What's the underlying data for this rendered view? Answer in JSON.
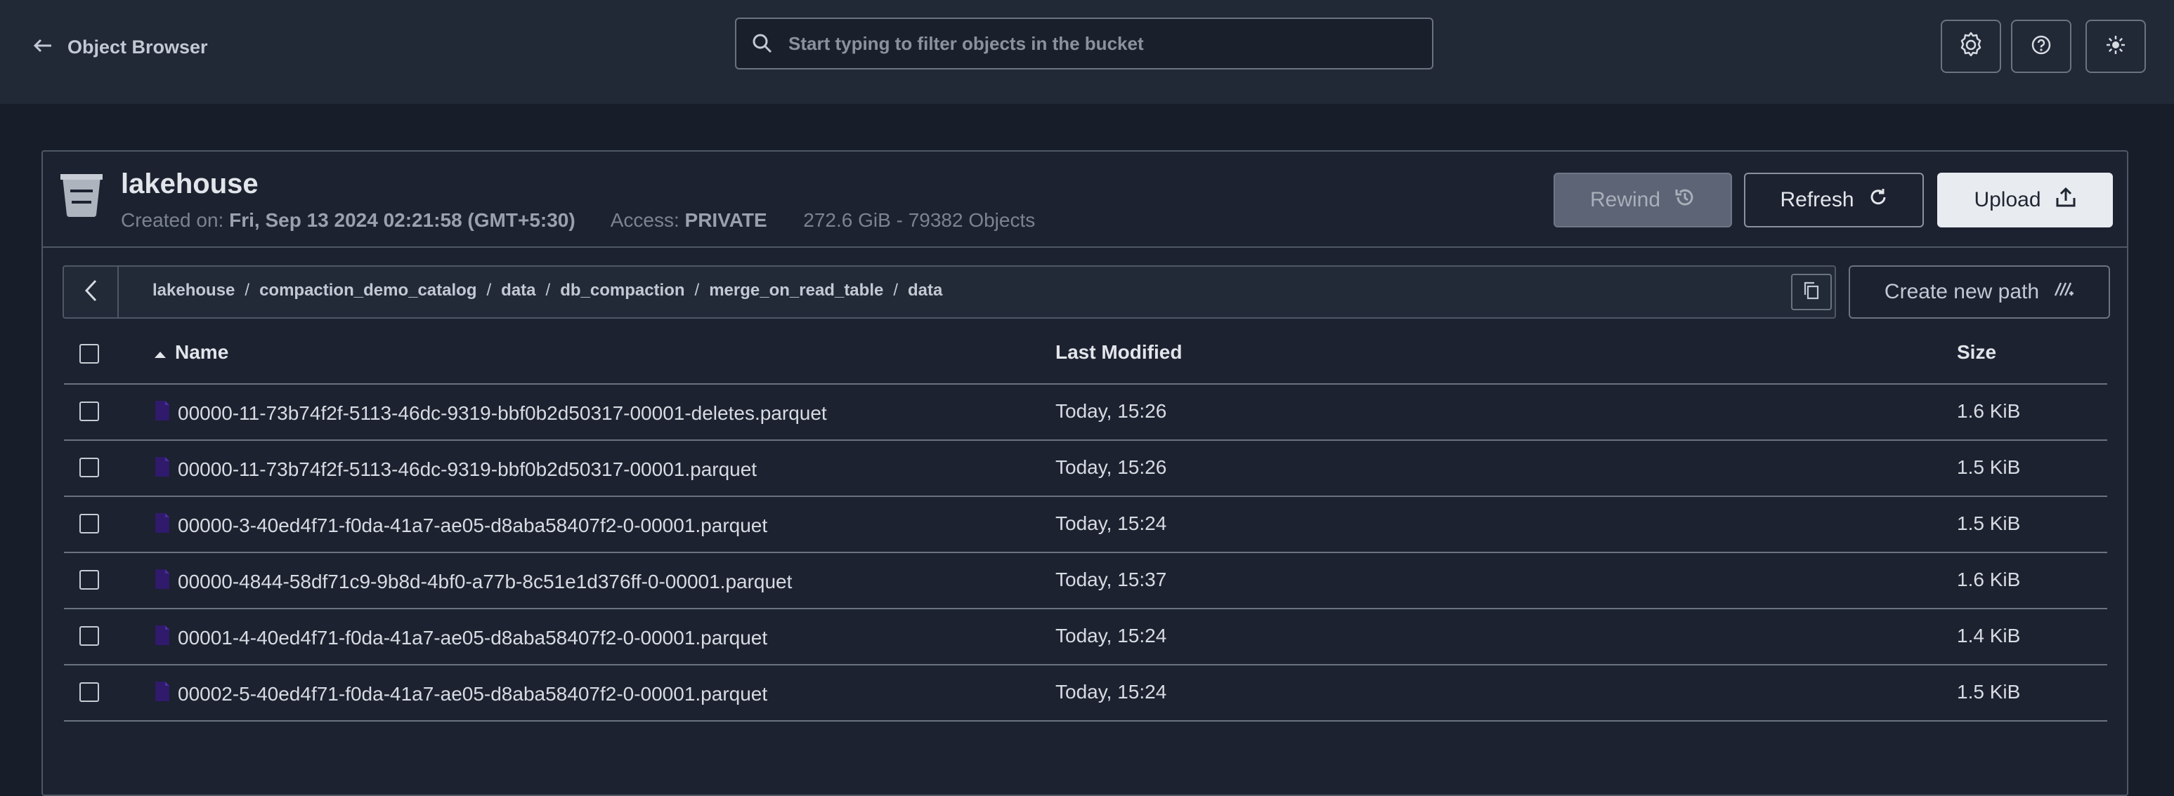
{
  "topbar": {
    "back_label": "Object Browser",
    "search_placeholder": "Start typing to filter objects in the bucket"
  },
  "bucket": {
    "name": "lakehouse",
    "created_label": "Created on:",
    "created_value": "Fri, Sep 13 2024 02:21:58 (GMT+5:30)",
    "access_label": "Access:",
    "access_value": "PRIVATE",
    "usage": "272.6 GiB - 79382 Objects"
  },
  "actions": {
    "rewind": "Rewind",
    "refresh": "Refresh",
    "upload": "Upload",
    "create_path": "Create new path"
  },
  "breadcrumb": [
    "lakehouse",
    "compaction_demo_catalog",
    "data",
    "db_compaction",
    "merge_on_read_table",
    "data"
  ],
  "table": {
    "columns": {
      "name": "Name",
      "modified": "Last Modified",
      "size": "Size"
    },
    "rows": [
      {
        "name": "00000-11-73b74f2f-5113-46dc-9319-bbf0b2d50317-00001-deletes.parquet",
        "modified": "Today, 15:26",
        "size": "1.6 KiB"
      },
      {
        "name": "00000-11-73b74f2f-5113-46dc-9319-bbf0b2d50317-00001.parquet",
        "modified": "Today, 15:26",
        "size": "1.5 KiB"
      },
      {
        "name": "00000-3-40ed4f71-f0da-41a7-ae05-d8aba58407f2-0-00001.parquet",
        "modified": "Today, 15:24",
        "size": "1.5 KiB"
      },
      {
        "name": "00000-4844-58df71c9-9b8d-4bf0-a77b-8c51e1d376ff-0-00001.parquet",
        "modified": "Today, 15:37",
        "size": "1.6 KiB"
      },
      {
        "name": "00001-4-40ed4f71-f0da-41a7-ae05-d8aba58407f2-0-00001.parquet",
        "modified": "Today, 15:24",
        "size": "1.4 KiB"
      },
      {
        "name": "00002-5-40ed4f71-f0da-41a7-ae05-d8aba58407f2-0-00001.parquet",
        "modified": "Today, 15:24",
        "size": "1.5 KiB"
      }
    ]
  },
  "icons": {
    "back": "arrow-left-icon",
    "search": "search-icon",
    "settings": "gear-icon",
    "help": "question-icon",
    "theme": "sun-icon",
    "bucket": "bucket-icon",
    "file": "file-icon"
  },
  "colors": {
    "background": "#181e29",
    "topbar": "#212836",
    "file_icon": "#2f1a6b",
    "upload_bg": "#e8ebef"
  }
}
